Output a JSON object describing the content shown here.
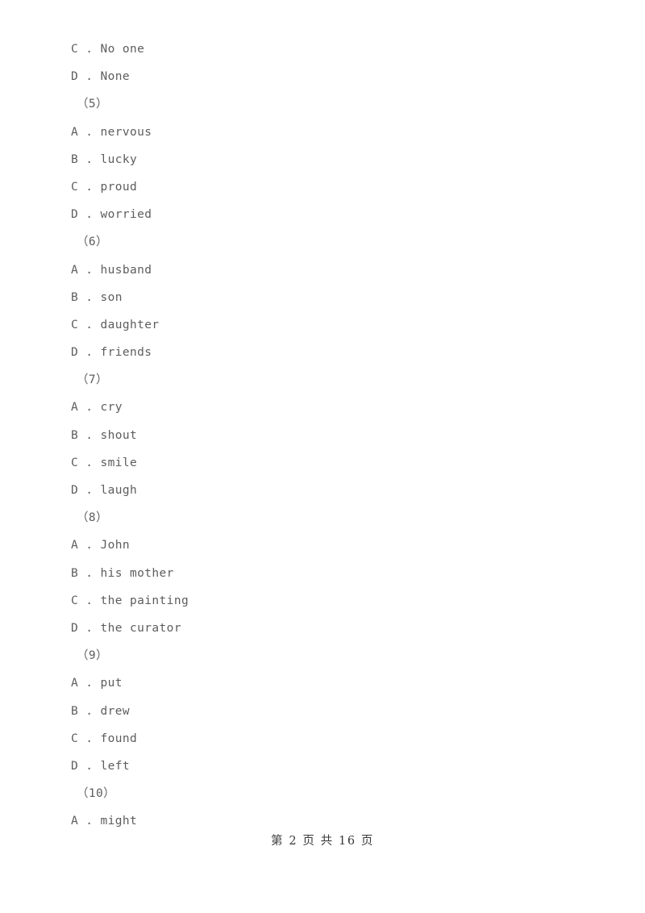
{
  "document": {
    "page_background": "#ffffff",
    "body_text_color": "#5d5d5d",
    "footer_text_color": "#3a3a3a"
  },
  "lines": [
    {
      "kind": "option",
      "text": "C . No one"
    },
    {
      "kind": "option",
      "text": "D . None"
    },
    {
      "kind": "qnum",
      "text": "（5）"
    },
    {
      "kind": "option",
      "text": "A . nervous"
    },
    {
      "kind": "option",
      "text": "B . lucky"
    },
    {
      "kind": "option",
      "text": "C . proud"
    },
    {
      "kind": "option",
      "text": "D . worried"
    },
    {
      "kind": "qnum",
      "text": "（6）"
    },
    {
      "kind": "option",
      "text": "A . husband"
    },
    {
      "kind": "option",
      "text": "B . son"
    },
    {
      "kind": "option",
      "text": "C . daughter"
    },
    {
      "kind": "option",
      "text": "D . friends"
    },
    {
      "kind": "qnum",
      "text": "（7）"
    },
    {
      "kind": "option",
      "text": "A . cry"
    },
    {
      "kind": "option",
      "text": "B . shout"
    },
    {
      "kind": "option",
      "text": "C . smile"
    },
    {
      "kind": "option",
      "text": "D . laugh"
    },
    {
      "kind": "qnum",
      "text": "（8）"
    },
    {
      "kind": "option",
      "text": "A . John"
    },
    {
      "kind": "option",
      "text": "B . his mother"
    },
    {
      "kind": "option",
      "text": "C . the painting"
    },
    {
      "kind": "option",
      "text": "D . the curator"
    },
    {
      "kind": "qnum",
      "text": "（9）"
    },
    {
      "kind": "option",
      "text": "A . put"
    },
    {
      "kind": "option",
      "text": "B . drew"
    },
    {
      "kind": "option",
      "text": "C . found"
    },
    {
      "kind": "option",
      "text": "D . left"
    },
    {
      "kind": "qnum",
      "text": "（10）"
    },
    {
      "kind": "option",
      "text": "A . might"
    }
  ],
  "footer": {
    "text": "第 2 页 共 16 页",
    "current_page": "2",
    "total_pages": "16"
  }
}
